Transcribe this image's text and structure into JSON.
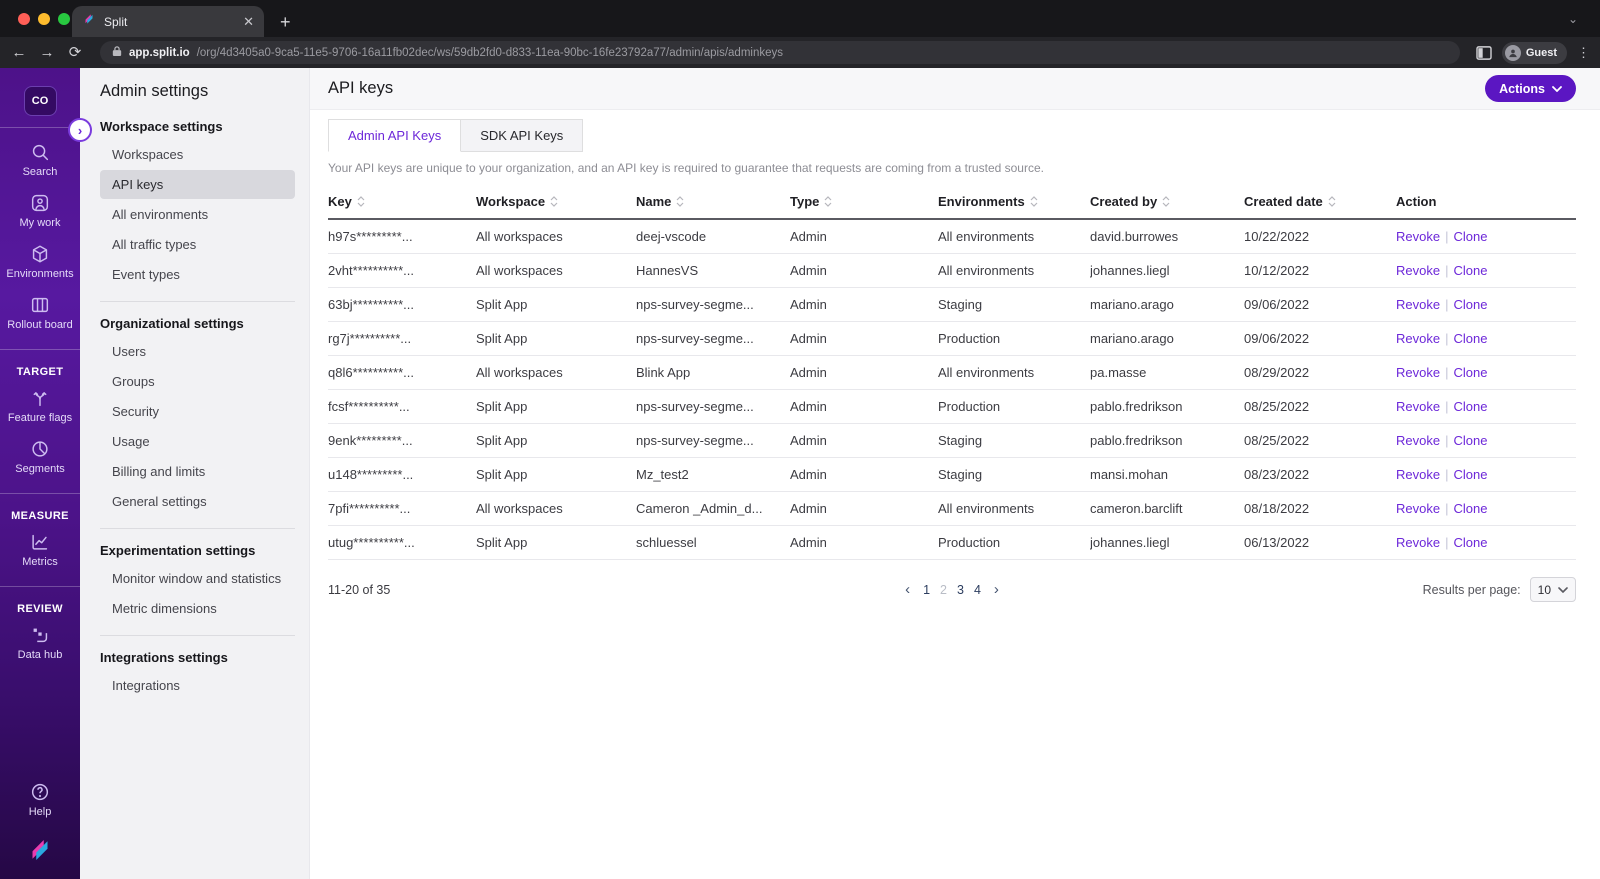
{
  "colors": {
    "accent_purple": "#6d28d9",
    "button_purple": "#5b16c2",
    "sidebar_purple_top": "#4d1289",
    "sidebar_purple_bottom": "#250845",
    "selected_nav_bg": "#d8d8dd",
    "link_purple": "#6d28d9"
  },
  "browser": {
    "tab_title": "Split",
    "url": {
      "domain": "app.split.io",
      "path": "/org/4d3405a0-9ca5-11e5-9706-16a11fb02dec/ws/59db2fd0-d833-11ea-90bc-16fe23792a77/admin/apis/adminkeys"
    },
    "profile_label": "Guest"
  },
  "sidebar": {
    "logo_text": "CO",
    "nav_items": [
      {
        "label": "Search",
        "icon": "search-icon"
      },
      {
        "label": "My work",
        "icon": "my-work-icon"
      },
      {
        "label": "Environments",
        "icon": "environments-icon"
      },
      {
        "label": "Rollout board",
        "icon": "rollout-board-icon"
      }
    ],
    "sections": [
      {
        "header": "TARGET",
        "items": [
          {
            "label": "Feature flags",
            "icon": "feature-flags-icon"
          },
          {
            "label": "Segments",
            "icon": "segments-icon"
          }
        ]
      },
      {
        "header": "MEASURE",
        "items": [
          {
            "label": "Metrics",
            "icon": "metrics-icon"
          }
        ]
      },
      {
        "header": "REVIEW",
        "items": [
          {
            "label": "Data hub",
            "icon": "data-hub-icon"
          }
        ]
      }
    ],
    "help_label": "Help"
  },
  "settings_nav": {
    "title": "Admin settings",
    "selected": "API keys",
    "groups": [
      {
        "header": "Workspace settings",
        "items": [
          "Workspaces",
          "API keys",
          "All environments",
          "All traffic types",
          "Event types"
        ]
      },
      {
        "header": "Organizational settings",
        "items": [
          "Users",
          "Groups",
          "Security",
          "Usage",
          "Billing and limits",
          "General settings"
        ]
      },
      {
        "header": "Experimentation settings",
        "items": [
          "Monitor window and statistics",
          "Metric dimensions"
        ]
      },
      {
        "header": "Integrations settings",
        "items": [
          "Integrations"
        ]
      }
    ]
  },
  "main": {
    "title": "API keys",
    "actions_button": "Actions",
    "tabs": [
      {
        "label": "Admin API Keys",
        "active": true
      },
      {
        "label": "SDK API Keys",
        "active": false
      }
    ],
    "description": "Your API keys are unique to your organization, and an API key is required to guarantee that requests are coming from a trusted source.",
    "table": {
      "columns": [
        {
          "label": "Key",
          "sortable": true
        },
        {
          "label": "Workspace",
          "sortable": true
        },
        {
          "label": "Name",
          "sortable": true
        },
        {
          "label": "Type",
          "sortable": true
        },
        {
          "label": "Environments",
          "sortable": true
        },
        {
          "label": "Created by",
          "sortable": true
        },
        {
          "label": "Created date",
          "sortable": true
        },
        {
          "label": "Action",
          "sortable": false
        }
      ],
      "row_actions": [
        "Revoke",
        "Clone"
      ],
      "rows": [
        {
          "key": "h97s*********...",
          "workspace": "All workspaces",
          "name": "deej-vscode",
          "type": "Admin",
          "environments": "All environments",
          "created_by": "david.burrowes",
          "created_date": "10/22/2022"
        },
        {
          "key": "2vht**********...",
          "workspace": "All workspaces",
          "name": "HannesVS",
          "type": "Admin",
          "environments": "All environments",
          "created_by": "johannes.liegl",
          "created_date": "10/12/2022"
        },
        {
          "key": "63bj**********...",
          "workspace": "Split App",
          "name": "nps-survey-segme...",
          "type": "Admin",
          "environments": "Staging",
          "created_by": "mariano.arago",
          "created_date": "09/06/2022"
        },
        {
          "key": "rg7j**********...",
          "workspace": "Split App",
          "name": "nps-survey-segme...",
          "type": "Admin",
          "environments": "Production",
          "created_by": "mariano.arago",
          "created_date": "09/06/2022"
        },
        {
          "key": "q8l6**********...",
          "workspace": "All workspaces",
          "name": "Blink App",
          "type": "Admin",
          "environments": "All environments",
          "created_by": "pa.masse",
          "created_date": "08/29/2022"
        },
        {
          "key": "fcsf**********...",
          "workspace": "Split App",
          "name": "nps-survey-segme...",
          "type": "Admin",
          "environments": "Production",
          "created_by": "pablo.fredrikson",
          "created_date": "08/25/2022"
        },
        {
          "key": "9enk*********...",
          "workspace": "Split App",
          "name": "nps-survey-segme...",
          "type": "Admin",
          "environments": "Staging",
          "created_by": "pablo.fredrikson",
          "created_date": "08/25/2022"
        },
        {
          "key": "u148*********...",
          "workspace": "Split App",
          "name": "Mz_test2",
          "type": "Admin",
          "environments": "Staging",
          "created_by": "mansi.mohan",
          "created_date": "08/23/2022"
        },
        {
          "key": "7pfi**********...",
          "workspace": "All workspaces",
          "name": "Cameron _Admin_d...",
          "type": "Admin",
          "environments": "All environments",
          "created_by": "cameron.barclift",
          "created_date": "08/18/2022"
        },
        {
          "key": "utug**********...",
          "workspace": "Split App",
          "name": "schluessel",
          "type": "Admin",
          "environments": "Production",
          "created_by": "johannes.liegl",
          "created_date": "06/13/2022"
        }
      ]
    },
    "pagination": {
      "range_text": "11-20 of 35",
      "pages": [
        "1",
        "2",
        "3",
        "4"
      ],
      "current_page": "2",
      "results_per_page_label": "Results per page:",
      "results_per_page_value": "10"
    }
  }
}
